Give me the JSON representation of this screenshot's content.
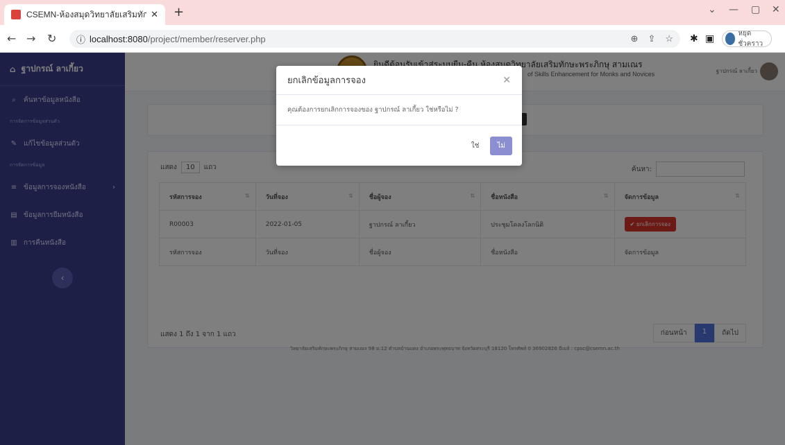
{
  "browser": {
    "tab_title": "CSEMN-ห้องสมุดวิทยาลัยเสริมทักษะ",
    "url_host": "localhost:8080",
    "url_path": "/project/member/reserver.php",
    "profile_label": "หยุดชั่วคราว"
  },
  "sidebar": {
    "brand": "ฐาปกรณ์ ลาเกี้ยว",
    "search_label": "ค้นหาข้อมูลหนังสือ",
    "section1": "การจัดการข้อมูลส่วนตัว",
    "item_profile": "แก้ไขข้อมูลส่วนตัว",
    "section2": "การจัดการข้อมูล",
    "item_reserve": "ข้อมูลการจองหนังสือ",
    "item_borrow": "ข้อมูลการยืมหนังสือ",
    "item_return": "การคืนหนังสือ"
  },
  "topnav": {
    "site_title": "ยินดีต้อนรับเข้าสู่ระบบยืม-คืน ห้องสมุดวิทยาลัยเสริมทักษะพระภิกษุ สามเณร",
    "site_subtitle": "of Skills Enhancement for Monks and Novices",
    "user_name": "ฐาปกรณ์ ลาเกี้ยว"
  },
  "table": {
    "length_prefix": "แสดง",
    "length_value": "10",
    "length_suffix": "แถว",
    "search_label": "ค้นหา:",
    "headers": [
      "รหัสการจอง",
      "วันที่จอง",
      "ชื่อผู้จอง",
      "ชื่อหนังสือ",
      "จัดการข้อมูล"
    ],
    "row": {
      "id": "R00003",
      "date": "2022-01-05",
      "name": "ฐาปกรณ์ ลาเกี้ยว",
      "book": "ประชุมโคลงโลกนิติ",
      "action": "ยกเลิกการจอง"
    },
    "info": "แสดง 1 ถึง 1 จาก 1 แถว",
    "prev": "ก่อนหน้า",
    "page": "1",
    "next": "ถัดไป"
  },
  "footer": "วิทยาลัยเสริมทักษะพระภิกษุ สามเณร 98 ม.12 ตำบลบ้านแดง อำเภอพระพุทธบาท จังหวัดสระบุรี 18120 โทรศัพท์ 0 36902826 อีเมล์ : cpsc@csemn.ac.th",
  "modal": {
    "title": "ยกเลิกข้อมูลการจอง",
    "body": "คุณต้องการยกเลิกการจองของ ฐาปกรณ์ ลาเกี้ยว ใช่หรือไม่ ?",
    "yes": "ใช่",
    "no": "ไม่"
  }
}
